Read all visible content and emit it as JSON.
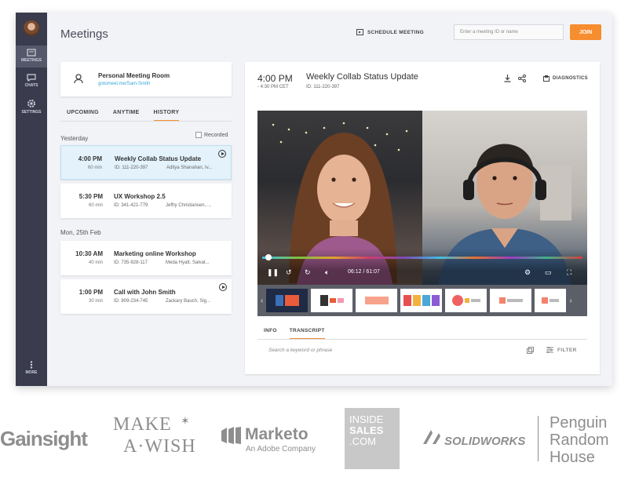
{
  "app": {
    "title": "Meetings",
    "schedule_label": "SCHEDULE MEETING",
    "meeting_input_placeholder": "Enter a meeting ID or name",
    "join_label": "JOIN",
    "accent": "#f68d2e"
  },
  "sidebar": {
    "items": [
      {
        "label": "MEETINGS",
        "icon": "meetings-icon"
      },
      {
        "label": "CHATS",
        "icon": "chat-icon"
      },
      {
        "label": "SETTINGS",
        "icon": "gear-icon"
      }
    ],
    "more_label": "MORE"
  },
  "room": {
    "title": "Personal Meeting Room",
    "link": "gotomeet.me/Sam-Smith"
  },
  "tabs": [
    "UPCOMING",
    "ANYTIME",
    "HISTORY"
  ],
  "recorded_label": "Recorded",
  "groups": [
    {
      "day": "Yesterday",
      "meetings": [
        {
          "time": "4:00 PM",
          "duration": "60 min",
          "title": "Weekly Collab Status Update",
          "id": "ID: 111-220-397",
          "attendees": "Aditya Shanahan, Iv...",
          "recorded": true
        },
        {
          "time": "5:30 PM",
          "duration": "60 min",
          "title": "UX Workshop 2.5",
          "id": "ID: 341-421-779",
          "attendees": "Jeffry Christiansen, ...",
          "recorded": false
        }
      ]
    },
    {
      "day": "Mon, 25th Feb",
      "meetings": [
        {
          "time": "10:30 AM",
          "duration": "40 min",
          "title": "Marketing online Workshop",
          "id": "ID: 735-928-117",
          "attendees": "Meda Hyatt, Salvat...",
          "recorded": false
        },
        {
          "time": "1:00 PM",
          "duration": "30 min",
          "title": "Call with John Smith",
          "id": "ID: 809-234-745",
          "attendees": "Zackary Bauch, Sig...",
          "recorded": true
        }
      ]
    }
  ],
  "detail": {
    "time": "4:00 PM",
    "time_range": "- 4:30 PM CET",
    "title": "Weekly Collab Status Update",
    "id": "ID: 111-220-397",
    "diagnostics_label": "DIAGNOSTICS",
    "video_time": "06:12 / 61:07",
    "progress": 0.02,
    "bottom_tabs": [
      "INFO",
      "TRANSCRIPT"
    ],
    "search_placeholder": "Search a keyword or phrase",
    "filter_label": "FILTER"
  },
  "logos": {
    "gainsight": "Gainsight",
    "makeawish_1": "MAKE",
    "makeawish_2": "A·WISH",
    "marketo": "Marketo",
    "marketo_sub": "An Adobe Company",
    "insidesales": [
      "INSIDE",
      "SALES",
      ".COM"
    ],
    "solidworks": "SOLIDWORKS",
    "penguin": [
      "Penguin",
      "Random",
      "House"
    ]
  }
}
